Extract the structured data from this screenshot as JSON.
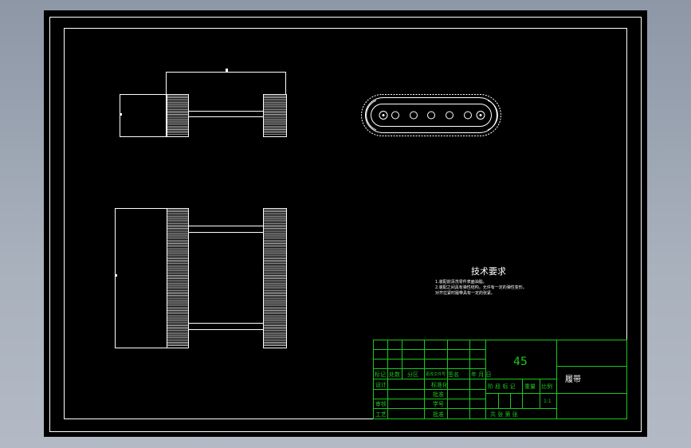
{
  "colors": {
    "background": "#000000",
    "geometry": "#ffffff",
    "title_block": "#19c81e",
    "desktop": "#9aa3b0"
  },
  "notes": {
    "title": "技术要求",
    "lines": [
      "1.装配前清洗零件表面油脂。",
      "2.装配之间具有弹性结构，允许有一定的弹性变形。",
      "对齐拉紧时履带具有一定的张紧。"
    ]
  },
  "title_block": {
    "material": "45",
    "part_name": "履带",
    "scale": "1:1",
    "header_row": [
      "标记",
      "处数",
      "分区",
      "更改文件号",
      "签名",
      "年 月 日"
    ],
    "row_labels": [
      "设计",
      "审核",
      "工艺"
    ],
    "mid_labels": [
      "标准化",
      "批准",
      "学号",
      "批准"
    ],
    "stage_labels": [
      "阶 段 标 记",
      "重量",
      "比例"
    ],
    "sheet_label": "共   张   第   张"
  }
}
